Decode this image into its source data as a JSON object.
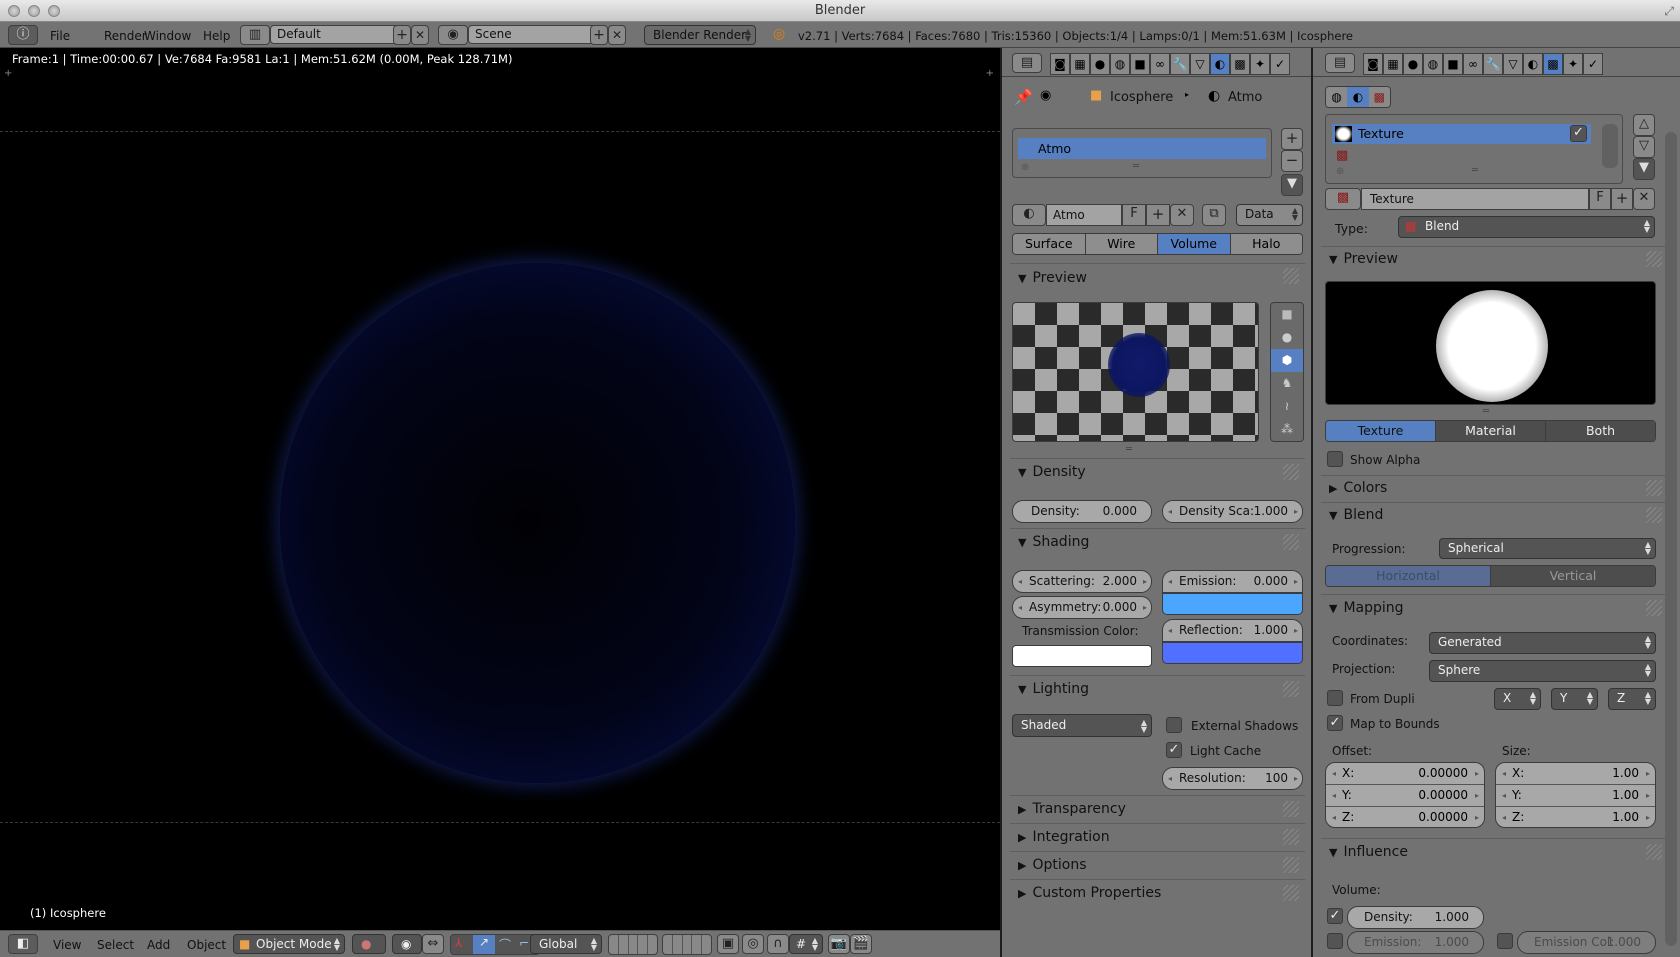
{
  "window": {
    "title": "Blender"
  },
  "infobar": {
    "menus": [
      "File",
      "Render",
      "Window",
      "Help"
    ],
    "layout": "Default",
    "scene": "Scene",
    "engine": "Blender Render",
    "stats": "v2.71 | Verts:7684 | Faces:7680 | Tris:15360 | Objects:1/4 | Lamps:0/1 | Mem:51.63M | Icosphere"
  },
  "viewport": {
    "render_info": "Frame:1 | Time:00:00.67 | Ve:7684 Fa:9581 La:1 | Mem:51.62M (0.00M, Peak 128.71M)",
    "object_label": "(1) Icosphere",
    "header": {
      "menus": [
        "View",
        "Select",
        "Add",
        "Object"
      ],
      "mode": "Object Mode",
      "orientation": "Global"
    }
  },
  "material_panel": {
    "breadcrumb": {
      "object": "Icosphere",
      "material": "Atmo"
    },
    "slot_list": [
      "Atmo"
    ],
    "material_name": "Atmo",
    "fake_user": "F",
    "link": "Data",
    "type_tabs": [
      {
        "label": "Surface",
        "active": false
      },
      {
        "label": "Wire",
        "active": false
      },
      {
        "label": "Volume",
        "active": true
      },
      {
        "label": "Halo",
        "active": false
      }
    ],
    "preview": {
      "title": "Preview"
    },
    "density": {
      "title": "Density",
      "density_label": "Density:",
      "density_value": "0.000",
      "scale_label": "Density Sca:",
      "scale_value": "1.000"
    },
    "shading": {
      "title": "Shading",
      "scattering_label": "Scattering:",
      "scattering_value": "2.000",
      "asymmetry_label": "Asymmetry:",
      "asymmetry_value": "0.000",
      "emission_label": "Emission:",
      "emission_value": "0.000",
      "emission_color": "#4aa6ff",
      "reflection_label": "Reflection:",
      "reflection_value": "1.000",
      "reflection_color": "#5170ff",
      "transmission_label": "Transmission Color:",
      "transmission_color": "#ffffff"
    },
    "lighting": {
      "title": "Lighting",
      "mode": "Shaded",
      "external_shadows": {
        "label": "External Shadows",
        "checked": false
      },
      "light_cache": {
        "label": "Light Cache",
        "checked": true
      },
      "resolution_label": "Resolution:",
      "resolution_value": "100"
    },
    "collapsed_sections": [
      "Transparency",
      "Integration",
      "Options",
      "Custom Properties"
    ]
  },
  "texture_panel": {
    "slots": [
      {
        "name": "Texture",
        "enabled": true
      }
    ],
    "texture_name": "Texture",
    "fake_user": "F",
    "type_label": "Type:",
    "type_value": "Blend",
    "preview": {
      "title": "Preview",
      "tabs": [
        {
          "label": "Texture",
          "active": true
        },
        {
          "label": "Material",
          "active": false
        },
        {
          "label": "Both",
          "active": false
        }
      ],
      "show_alpha": {
        "label": "Show Alpha",
        "checked": false
      }
    },
    "colors": {
      "title": "Colors"
    },
    "blend": {
      "title": "Blend",
      "progression_label": "Progression:",
      "progression_value": "Spherical",
      "direction_tabs": [
        {
          "label": "Horizontal",
          "active": true
        },
        {
          "label": "Vertical",
          "active": false
        }
      ]
    },
    "mapping": {
      "title": "Mapping",
      "coordinates_label": "Coordinates:",
      "coordinates_value": "Generated",
      "projection_label": "Projection:",
      "projection_value": "Sphere",
      "from_dupli": {
        "label": "From Dupli",
        "checked": false
      },
      "axes": [
        "X",
        "Y",
        "Z"
      ],
      "map_to_bounds": {
        "label": "Map to Bounds",
        "checked": true
      },
      "offset_label": "Offset:",
      "offset": [
        {
          "axis": "X:",
          "value": "0.00000"
        },
        {
          "axis": "Y:",
          "value": "0.00000"
        },
        {
          "axis": "Z:",
          "value": "0.00000"
        }
      ],
      "size_label": "Size:",
      "size": [
        {
          "axis": "X:",
          "value": "1.00"
        },
        {
          "axis": "Y:",
          "value": "1.00"
        },
        {
          "axis": "Z:",
          "value": "1.00"
        }
      ]
    },
    "influence": {
      "title": "Influence",
      "volume_label": "Volume:",
      "density": {
        "label": "Density:",
        "value": "1.000",
        "checked": true
      },
      "emission": {
        "label": "Emission:",
        "value": "1.000",
        "checked": false
      },
      "emission_col": {
        "label": "Emission Col:",
        "value": "1.000",
        "checked": false
      }
    }
  }
}
